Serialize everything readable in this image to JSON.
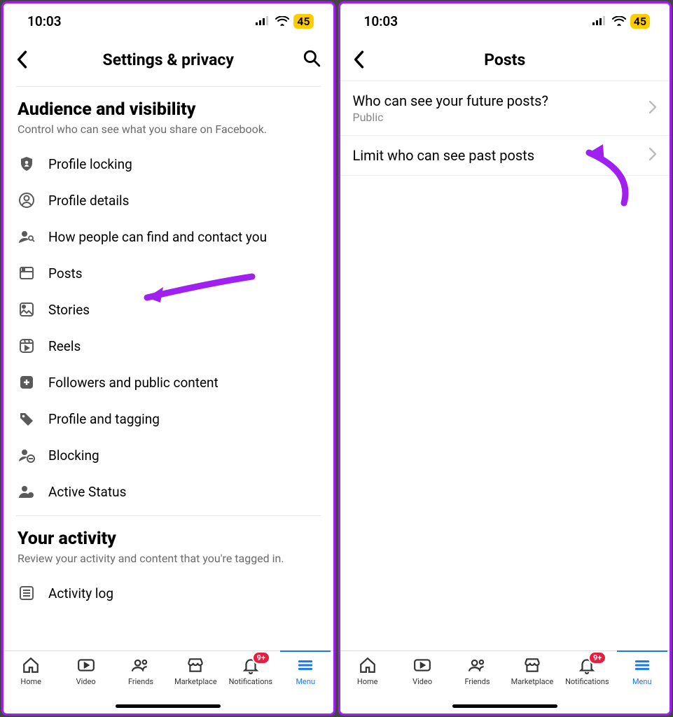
{
  "status": {
    "time": "10:03",
    "battery": "45"
  },
  "left": {
    "header_title": "Settings & privacy",
    "section1_title": "Audience and visibility",
    "section1_sub": "Control who can see what you share on Facebook.",
    "items": [
      "Profile locking",
      "Profile details",
      "How people can find and contact you",
      "Posts",
      "Stories",
      "Reels",
      "Followers and public content",
      "Profile and tagging",
      "Blocking",
      "Active Status"
    ],
    "section2_title": "Your activity",
    "section2_sub": "Review your activity and content that you're tagged in.",
    "activity_log": "Activity log"
  },
  "right": {
    "header_title": "Posts",
    "rows": [
      {
        "title": "Who can see your future posts?",
        "sub": "Public"
      },
      {
        "title": "Limit who can see past posts",
        "sub": ""
      }
    ]
  },
  "tabs": {
    "home": "Home",
    "video": "Video",
    "friends": "Friends",
    "marketplace": "Marketplace",
    "notifications": "Notifications",
    "menu": "Menu",
    "badge": "9+"
  }
}
